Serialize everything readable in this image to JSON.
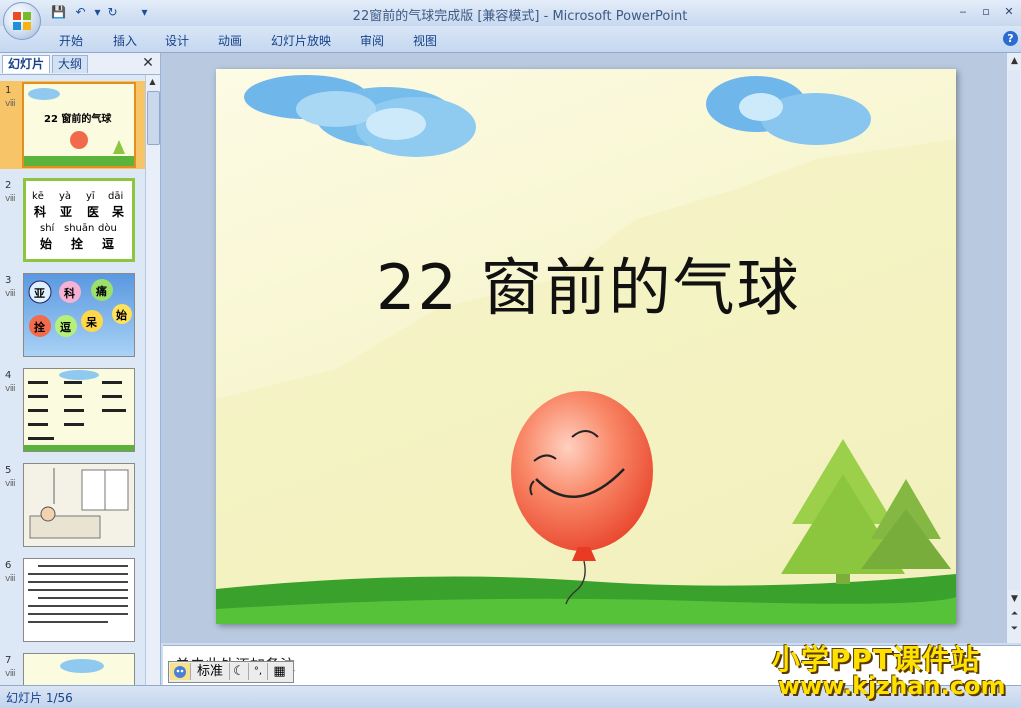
{
  "window": {
    "title": "22窗前的气球完成版 [兼容模式] - Microsoft PowerPoint",
    "minimize": "‒",
    "restore": "▫",
    "close": "✕"
  },
  "quick_access": {
    "save": "💾",
    "undo": "↶",
    "redo": "↻",
    "dropdown": "▾"
  },
  "ribbon": {
    "tabs": [
      "开始",
      "插入",
      "设计",
      "动画",
      "幻灯片放映",
      "审阅",
      "视图"
    ],
    "help": "?"
  },
  "panel": {
    "tab_slides": "幻灯片",
    "tab_outline": "大纲",
    "close": "✕"
  },
  "thumbnails": [
    {
      "num": "1",
      "mark": "ⅷ",
      "title": "22 窗前的气球"
    },
    {
      "num": "2",
      "mark": "ⅷ",
      "pinyin": [
        "kē",
        "yà",
        "yī",
        "dāi"
      ],
      "chars": [
        "科",
        "亚",
        "医",
        "呆"
      ],
      "pinyin2": [
        "shí",
        "shuān",
        "dòu"
      ],
      "chars2": [
        "始",
        "拴",
        "逗"
      ]
    },
    {
      "num": "3",
      "mark": "ⅷ",
      "balloons": [
        "亚",
        "科",
        "痛",
        "拴",
        "逗",
        "呆",
        "始"
      ]
    },
    {
      "num": "4",
      "mark": "ⅷ"
    },
    {
      "num": "5",
      "mark": "ⅷ"
    },
    {
      "num": "6",
      "mark": "ⅷ"
    },
    {
      "num": "7",
      "mark": "ⅷ"
    }
  ],
  "slide": {
    "title": "22  窗前的气球"
  },
  "notes": {
    "placeholder": "单击此处添加备注"
  },
  "ime": {
    "mode": "标准",
    "moon": "☾",
    "punct": "°,",
    "keyboard": "▦"
  },
  "status": {
    "slide_count": "幻灯片 1/56"
  },
  "watermark": {
    "line1": "小学PPT课件站",
    "line2": "www.kjzhan.com"
  },
  "colors": {
    "ribbon": "#c5d7ef",
    "selected_thumb": "#f8c468",
    "balloon": "#f26a4c",
    "tree": "#8cc63f",
    "grass": "#3aa12c"
  }
}
